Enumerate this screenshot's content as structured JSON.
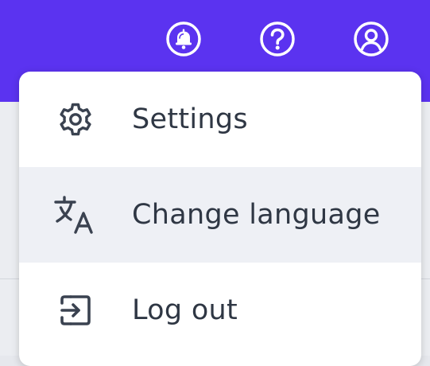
{
  "colors": {
    "top_bar": "#5b33f0",
    "menu_bg": "#ffffff",
    "menu_highlight": "#eef0f5",
    "text": "#2f3744",
    "icon": "#3a4250"
  },
  "header": {
    "icons": [
      {
        "name": "bell-icon"
      },
      {
        "name": "help-icon"
      },
      {
        "name": "user-account-icon"
      }
    ]
  },
  "menu": {
    "items": [
      {
        "label": "Settings",
        "icon": "gear-icon"
      },
      {
        "label": "Change language",
        "icon": "translate-icon",
        "highlighted": true
      },
      {
        "label": "Log out",
        "icon": "logout-icon"
      }
    ]
  }
}
